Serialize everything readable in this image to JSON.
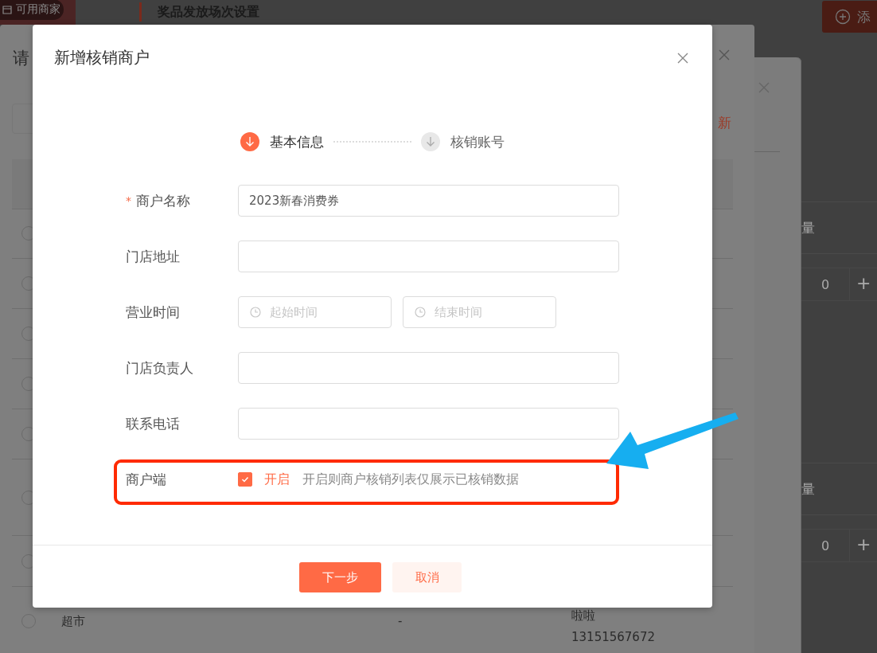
{
  "background": {
    "badge": "可用商家",
    "page_title": "奖品发放场次设置",
    "add_button": "添",
    "panel_title": "请",
    "refresh_link": "新",
    "list_rows": [
      {
        "selected": false
      },
      {
        "selected": false
      },
      {
        "selected": false
      },
      {
        "selected": false
      },
      {
        "selected": false
      },
      {
        "selected": false
      },
      {
        "selected": false
      },
      {
        "selected": false,
        "name": "超市",
        "column_2": "-",
        "column_3": "啦啦",
        "column_4": "13151567672"
      }
    ],
    "right_table": [
      {
        "header": "量",
        "value": "0",
        "plus": "+"
      },
      {
        "header": "量",
        "value": "0",
        "plus": "+"
      }
    ]
  },
  "dialog": {
    "title": "新增核销商户",
    "steps": [
      {
        "label": "基本信息",
        "selected": true
      },
      {
        "label": "核销账号",
        "selected": false
      }
    ],
    "fields": [
      {
        "kind": "text",
        "label": "商户名称",
        "required_mark": "*",
        "value": "2023新春消费券"
      },
      {
        "kind": "text",
        "label": "门店地址"
      },
      {
        "kind": "time_range",
        "label": "营业时间",
        "start_placeholder": "起始时间",
        "end_placeholder": "结束时间"
      },
      {
        "kind": "text",
        "label": "门店负责人"
      },
      {
        "kind": "text",
        "label": "联系电话"
      },
      {
        "kind": "checkbox",
        "label": "商户端",
        "checked": true,
        "option": "开启",
        "hint": "开启则商户核销列表仅展示已核销数据"
      }
    ],
    "buttons": [
      {
        "label": "下一步",
        "kind": "primary"
      },
      {
        "label": "取消",
        "kind": "secondary"
      }
    ]
  }
}
